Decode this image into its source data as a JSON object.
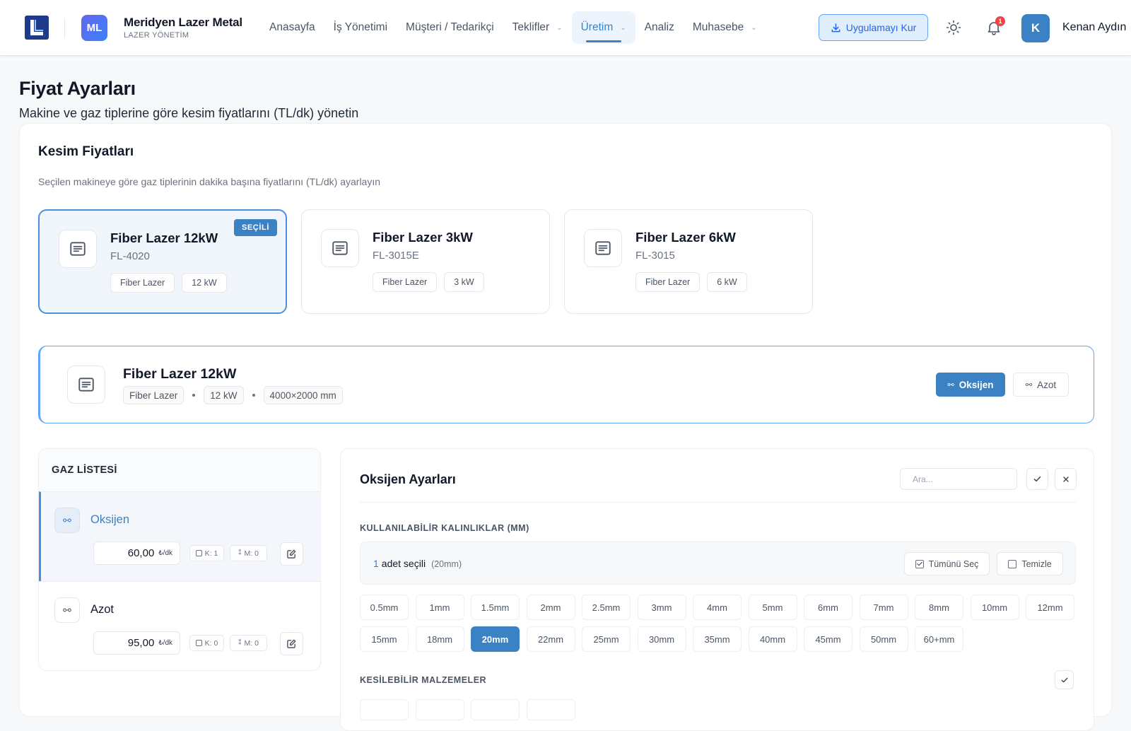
{
  "brand": {
    "badge": "ML",
    "name": "Meridyen Lazer Metal",
    "subtitle": "LAZER YÖNETİM"
  },
  "nav": [
    {
      "label": "Anasayfa",
      "dropdown": false,
      "active": false
    },
    {
      "label": "İş Yönetimi",
      "dropdown": false,
      "active": false
    },
    {
      "label": "Müşteri / Tedarikçi",
      "dropdown": false,
      "active": false
    },
    {
      "label": "Teklifler",
      "dropdown": true,
      "active": false
    },
    {
      "label": "Üretim",
      "dropdown": true,
      "active": true
    },
    {
      "label": "Analiz",
      "dropdown": false,
      "active": false
    },
    {
      "label": "Muhasebe",
      "dropdown": true,
      "active": false
    }
  ],
  "header": {
    "install_label": "Uygulamayı Kur",
    "notification_count": "1",
    "avatar_initial": "K",
    "user_name": "Kenan Aydın",
    "icons": [
      "download-icon",
      "sun-icon",
      "bell-icon",
      "chevron-down-icon"
    ]
  },
  "page": {
    "title": "Fiyat Ayarları",
    "subtitle": "Makine ve gaz tiplerine göre kesim fiyatlarını (TL/dk) yönetin"
  },
  "section": {
    "title": "Kesim Fiyatları",
    "description": "Seçilen makineye göre gaz tiplerinin dakika başına fiyatlarını (TL/dk) ayarlayın"
  },
  "machines": [
    {
      "name": "Fiber Lazer 12kW",
      "code": "FL-4020",
      "type": "Fiber Lazer",
      "power": "12 kW",
      "selected": true,
      "badge": "SEÇİLİ"
    },
    {
      "name": "Fiber Lazer 3kW",
      "code": "FL-3015E",
      "type": "Fiber Lazer",
      "power": "3 kW",
      "selected": false
    },
    {
      "name": "Fiber Lazer 6kW",
      "code": "FL-3015",
      "type": "Fiber Lazer",
      "power": "6 kW",
      "selected": false
    }
  ],
  "selected_machine": {
    "name": "Fiber Lazer 12kW",
    "type": "Fiber Lazer",
    "power": "12 kW",
    "bed": "4000×2000 mm",
    "gas_buttons": [
      {
        "label": "Oksijen",
        "active": true
      },
      {
        "label": "Azot",
        "active": false
      }
    ]
  },
  "gas_list": {
    "title": "GAZ LİSTESİ",
    "items": [
      {
        "name": "Oksijen",
        "icon_text": "⚯",
        "price": "60,00",
        "unit": "₺/dk",
        "k": "K: 1",
        "m": "M: 0",
        "active": true
      },
      {
        "name": "Azot",
        "icon_text": "⚯",
        "price": "95,00",
        "unit": "₺/dk",
        "k": "K: 0",
        "m": "M: 0",
        "active": false
      }
    ]
  },
  "settings": {
    "title": "Oksijen Ayarları",
    "search_placeholder": "Ara...",
    "thickness_label": "KULLANILABİLİR KALINLIKLAR (MM)",
    "selected_count": "1",
    "selected_text": "adet seçili",
    "selected_hint": "(20mm)",
    "select_all_label": "Tümünü Seç",
    "clear_label": "Temizle",
    "thicknesses": [
      {
        "label": "0.5mm",
        "on": false
      },
      {
        "label": "1mm",
        "on": false
      },
      {
        "label": "1.5mm",
        "on": false
      },
      {
        "label": "2mm",
        "on": false
      },
      {
        "label": "2.5mm",
        "on": false
      },
      {
        "label": "3mm",
        "on": false
      },
      {
        "label": "4mm",
        "on": false
      },
      {
        "label": "5mm",
        "on": false
      },
      {
        "label": "6mm",
        "on": false
      },
      {
        "label": "7mm",
        "on": false
      },
      {
        "label": "8mm",
        "on": false
      },
      {
        "label": "10mm",
        "on": false
      },
      {
        "label": "12mm",
        "on": false
      },
      {
        "label": "15mm",
        "on": false
      },
      {
        "label": "18mm",
        "on": false
      },
      {
        "label": "20mm",
        "on": true
      },
      {
        "label": "22mm",
        "on": false
      },
      {
        "label": "25mm",
        "on": false
      },
      {
        "label": "30mm",
        "on": false
      },
      {
        "label": "35mm",
        "on": false
      },
      {
        "label": "40mm",
        "on": false
      },
      {
        "label": "45mm",
        "on": false
      },
      {
        "label": "50mm",
        "on": false
      },
      {
        "label": "60+mm",
        "on": false
      }
    ],
    "materials_label": "KESİLEBİLİR MALZEMELER"
  },
  "colors": {
    "accent": "#3b82c4",
    "brand_dark": "#1e3a8a",
    "danger": "#ef4444"
  }
}
